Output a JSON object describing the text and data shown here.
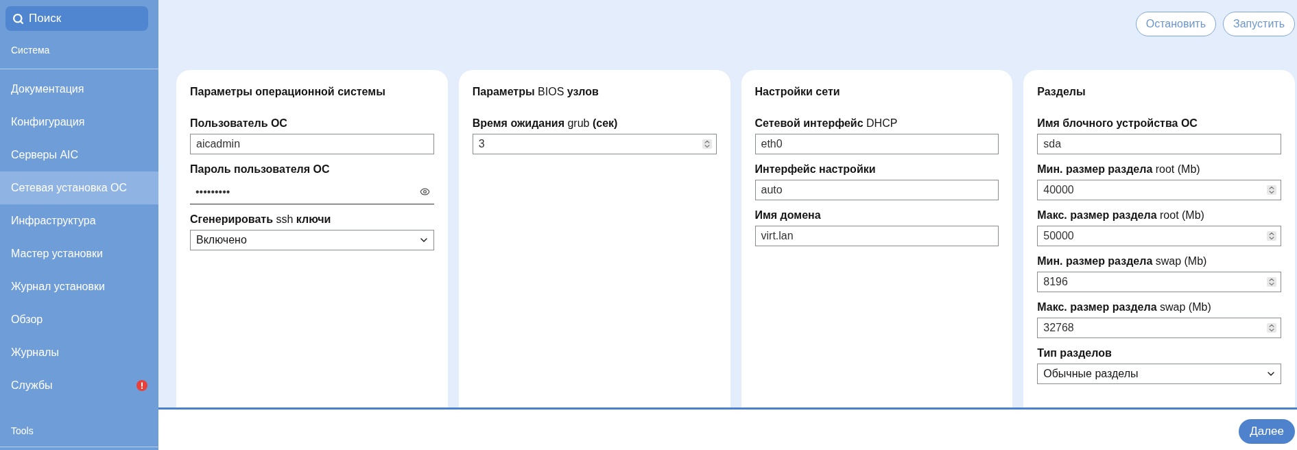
{
  "sidebar": {
    "search": {
      "placeholder": "Поиск"
    },
    "section": "Система",
    "items": [
      {
        "label": "Документация",
        "selected": false,
        "alert": false
      },
      {
        "label": "Конфигурация",
        "selected": false,
        "alert": false
      },
      {
        "label": "Серверы AIC",
        "selected": false,
        "alert": false
      },
      {
        "label": "Сетевая установка ОС",
        "selected": true,
        "alert": false
      },
      {
        "label": "Инфраструктура",
        "selected": false,
        "alert": false
      },
      {
        "label": "Мастер установки",
        "selected": false,
        "alert": false
      },
      {
        "label": "Журнал установки",
        "selected": false,
        "alert": false
      },
      {
        "label": "Обзор",
        "selected": false,
        "alert": false
      },
      {
        "label": "Журналы",
        "selected": false,
        "alert": false
      },
      {
        "label": "Службы",
        "selected": false,
        "alert": true
      }
    ],
    "footer_section": "Tools"
  },
  "toolbar": {
    "buttons": [
      "Остановить",
      "Запустить"
    ]
  },
  "cards": [
    {
      "title": "Параметры операционной системы",
      "fields": [
        {
          "kind": "text",
          "label": "**Пользователь ОС**",
          "value": "aicadmin"
        },
        {
          "kind": "password",
          "label": "**Пароль пользователя ОС**",
          "value": "•••••••••"
        },
        {
          "kind": "select",
          "label": "**Сгенерировать** ssh **ключи**",
          "value": "Включено"
        }
      ]
    },
    {
      "title": "**Параметры** BIOS **узлов**",
      "fields": [
        {
          "kind": "number",
          "label": "**Время ожидания** grub **(сек)**",
          "value": "3"
        }
      ]
    },
    {
      "title": "**Настройки сети**",
      "fields": [
        {
          "kind": "text",
          "label": "**Сетевой интерфейс** DHCP",
          "value": "eth0"
        },
        {
          "kind": "text",
          "label": "**Интерфейс настройки**",
          "value": "auto"
        },
        {
          "kind": "text",
          "label": "**Имя домена**",
          "value": "virt.lan"
        }
      ]
    },
    {
      "title": "**Разделы**",
      "fields": [
        {
          "kind": "text",
          "label": "**Имя блочного устройства ОС**",
          "value": "sda"
        },
        {
          "kind": "number",
          "label": "**Мин. размер раздела** root (Mb)",
          "value": "40000"
        },
        {
          "kind": "number",
          "label": "**Макс. размер раздела** root (Mb)",
          "value": "50000"
        },
        {
          "kind": "number",
          "label": "**Мин. размер раздела** swap (Mb)",
          "value": "8196"
        },
        {
          "kind": "number",
          "label": "**Макс. размер раздела** swap (Mb)",
          "value": "32768"
        },
        {
          "kind": "select",
          "label": "**Тип разделов**",
          "value": "Обычные разделы"
        }
      ]
    }
  ],
  "footer": {
    "button": "Далее"
  }
}
